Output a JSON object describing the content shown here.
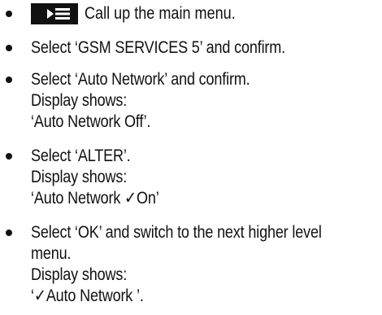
{
  "steps": [
    {
      "icon": "menu-key-icon",
      "text": "Call up the main menu."
    },
    {
      "text": "Select ‘GSM SERVICES 5’ and confirm."
    },
    {
      "line1": "Select ‘Auto Network’ and confirm.",
      "line2": "Display shows:",
      "line3": "‘Auto Network Off’."
    },
    {
      "line1": "Select ‘ALTER’.",
      "line2": "Display shows:",
      "line3_pre": "‘Auto Network ",
      "line3_check": "✓",
      "line3_post": "On’"
    },
    {
      "line1": "Select ‘OK’ and switch to the next higher level",
      "line2": "menu.",
      "line3": "Display shows:",
      "line4_pre": "‘",
      "line4_check": "✓",
      "line4_post": "Auto Network ’."
    }
  ]
}
